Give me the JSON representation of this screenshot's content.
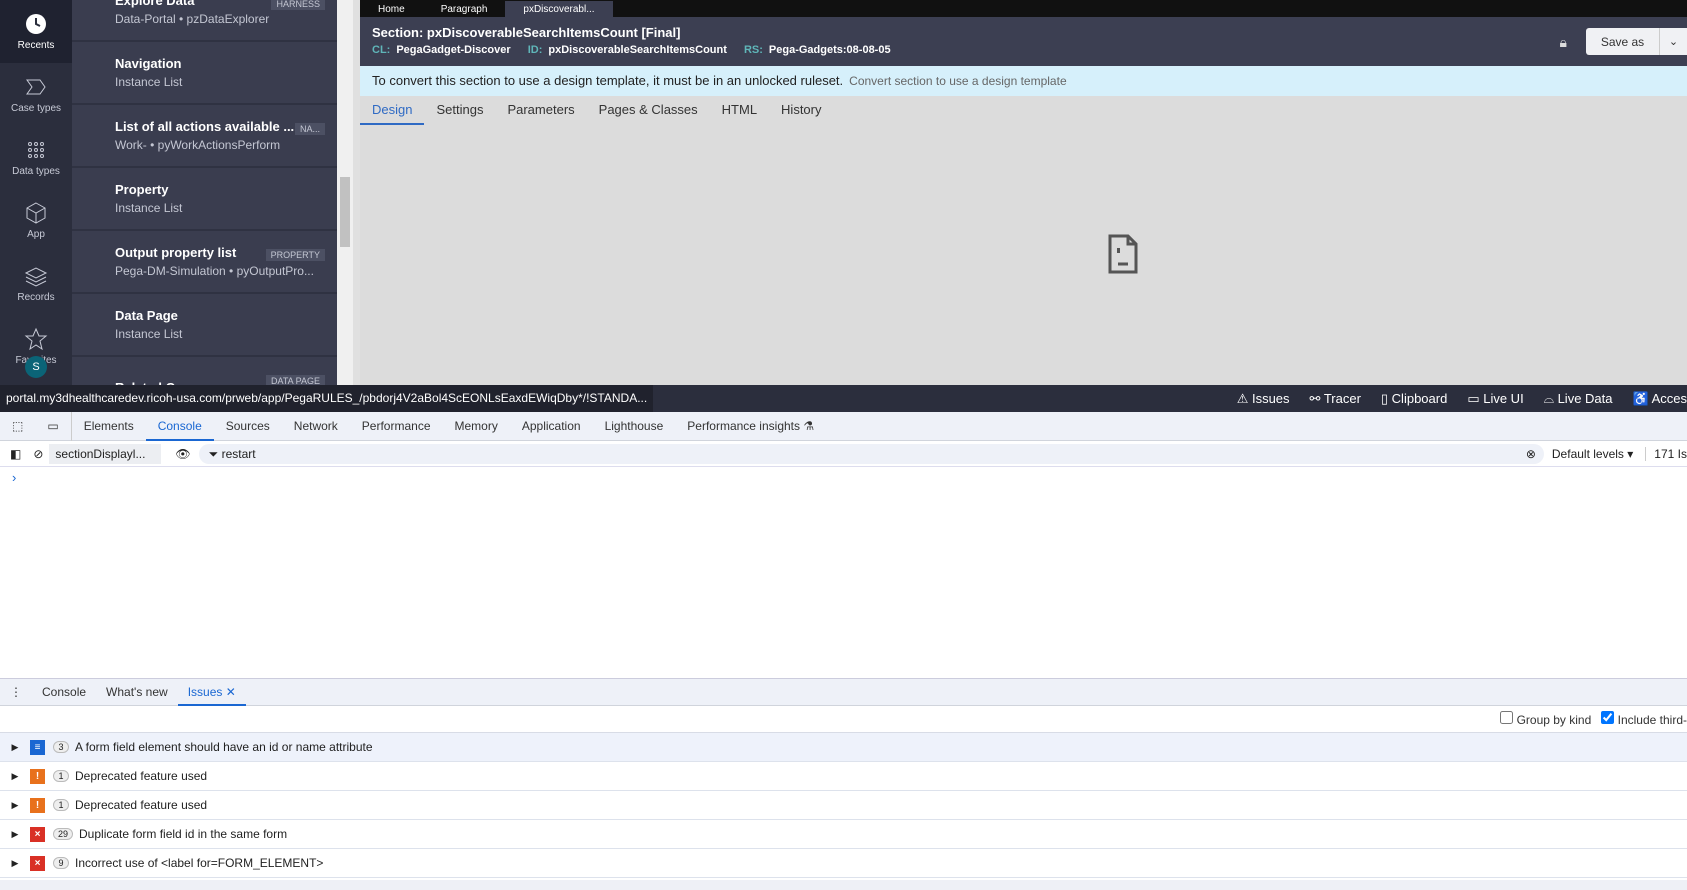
{
  "rail": [
    {
      "label": "Recents",
      "icon": "clock-icon"
    },
    {
      "label": "Case types",
      "icon": "case-icon"
    },
    {
      "label": "Data types",
      "icon": "grid-dots-icon"
    },
    {
      "label": "App",
      "icon": "cube-icon"
    },
    {
      "label": "Records",
      "icon": "layers-icon"
    },
    {
      "label": "Favorites",
      "icon": "star-icon"
    }
  ],
  "avatar": "S",
  "list": [
    {
      "title": "Explore Data",
      "sub": "Data-Portal • pzDataExplorer",
      "badge": "HARNESS"
    },
    {
      "title": "Navigation",
      "sub": "Instance List",
      "badge": ""
    },
    {
      "title": "List of all actions available ...",
      "sub": "Work- • pyWorkActionsPerform",
      "badge": "NA..."
    },
    {
      "title": "Property",
      "sub": "Instance List",
      "badge": ""
    },
    {
      "title": "Output property list",
      "sub": "Pega-DM-Simulation • pyOutputPro...",
      "badge": "PROPERTY"
    },
    {
      "title": "Data Page",
      "sub": "Instance List",
      "badge": ""
    },
    {
      "title": "Related Cases",
      "sub": "",
      "badge": "DATA PAGE"
    }
  ],
  "tabs": [
    "Home",
    "Paragraph",
    "pxDiscoverabl..."
  ],
  "header": {
    "title": "Section: pxDiscoverableSearchItemsCount [Final]",
    "cl_label": "CL:",
    "cl": "PegaGadget-Discover",
    "id_label": "ID:",
    "id": "pxDiscoverableSearchItemsCount",
    "rs_label": "RS:",
    "rs": "Pega-Gadgets:08-08-05",
    "save_as": "Save as"
  },
  "banner": {
    "text": "To convert this section to use a design template, it must be in an unlocked ruleset.",
    "link": "Convert section to use a design template"
  },
  "rule_tabs": [
    "Design",
    "Settings",
    "Parameters",
    "Pages & Classes",
    "HTML",
    "History"
  ],
  "status": {
    "url": "portal.my3dhealthcaredev.ricoh-usa.com/prweb/app/PegaRULES_/pbdorj4V2aBol4ScEONLsEaxdEWiqDby*/!STANDA...",
    "tools": [
      "⚠ Issues",
      "⚯ Tracer",
      "▯ Clipboard",
      "▭ Live UI",
      "⌓ Live Data",
      "♿ Acces"
    ]
  },
  "devtools": {
    "tabs": [
      "Elements",
      "Console",
      "Sources",
      "Network",
      "Performance",
      "Memory",
      "Application",
      "Lighthouse",
      "Performance insights ⚗"
    ],
    "context": "sectionDisplayl...",
    "filter": "restart",
    "levels": "Default levels ▾",
    "count": "171 Is",
    "prompt": "›"
  },
  "drawer": {
    "tabs": [
      "Console",
      "What's new",
      "Issues"
    ],
    "group_by_kind": "Group by kind",
    "include_third": "Include third-"
  },
  "issues": [
    {
      "kind": "info",
      "color": "#1a67d2",
      "glyph": "≡",
      "count": "3",
      "text": "A form field element should have an id or name attribute"
    },
    {
      "kind": "warning",
      "color": "#e8711c",
      "glyph": "!",
      "count": "1",
      "text": "Deprecated feature used"
    },
    {
      "kind": "warning",
      "color": "#e8711c",
      "glyph": "!",
      "count": "1",
      "text": "Deprecated feature used"
    },
    {
      "kind": "error",
      "color": "#d93025",
      "glyph": "×",
      "count": "29",
      "text": "Duplicate form field id in the same form"
    },
    {
      "kind": "error",
      "color": "#d93025",
      "glyph": "×",
      "count": "9",
      "text": "Incorrect use of <label for=FORM_ELEMENT>"
    }
  ]
}
